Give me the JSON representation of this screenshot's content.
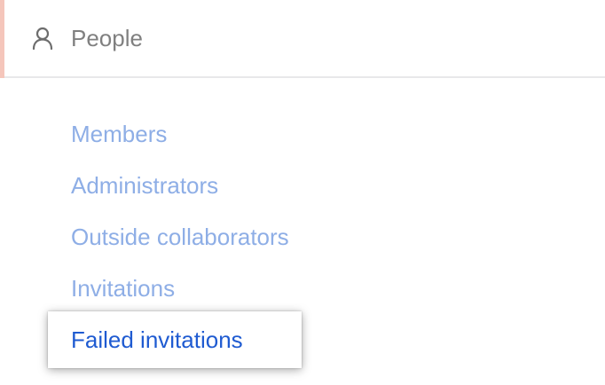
{
  "section": {
    "title": "People",
    "icon": "person-icon",
    "accent_color": "#f5c6bb"
  },
  "subnav": {
    "items": [
      {
        "label": "Members"
      },
      {
        "label": "Administrators"
      },
      {
        "label": "Outside collaborators"
      },
      {
        "label": "Invitations"
      },
      {
        "label": "Failed invitations",
        "active": true
      }
    ],
    "link_color": "#8eaee6",
    "active_color": "#1f5bd1"
  }
}
